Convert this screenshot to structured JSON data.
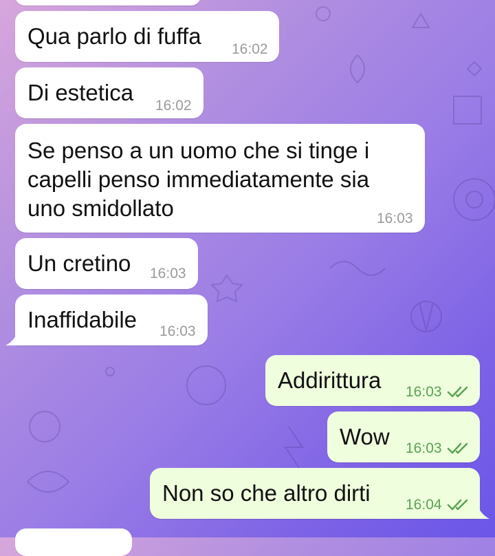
{
  "colors": {
    "incoming_bubble": "#ffffff",
    "outgoing_bubble": "#effedd",
    "incoming_time": "#9a9a9a",
    "outgoing_time": "#59a352"
  },
  "messages": [
    {
      "direction": "in",
      "text": "Qua parlo di fuffa",
      "time": "16:02"
    },
    {
      "direction": "in",
      "text": "Di estetica",
      "time": "16:02"
    },
    {
      "direction": "in",
      "text": "Se penso a un uomo che si tinge i capelli penso immediatamente sia uno smidollato",
      "time": "16:03"
    },
    {
      "direction": "in",
      "text": "Un cretino",
      "time": "16:03"
    },
    {
      "direction": "in",
      "text": "Inaffidabile",
      "time": "16:03"
    },
    {
      "direction": "out",
      "text": "Addirittura",
      "time": "16:03",
      "status_icon": "double-check-icon"
    },
    {
      "direction": "out",
      "text": "Wow",
      "time": "16:03",
      "status_icon": "double-check-icon"
    },
    {
      "direction": "out",
      "text": "Non so che altro dirti",
      "time": "16:04",
      "status_icon": "double-check-icon"
    }
  ]
}
